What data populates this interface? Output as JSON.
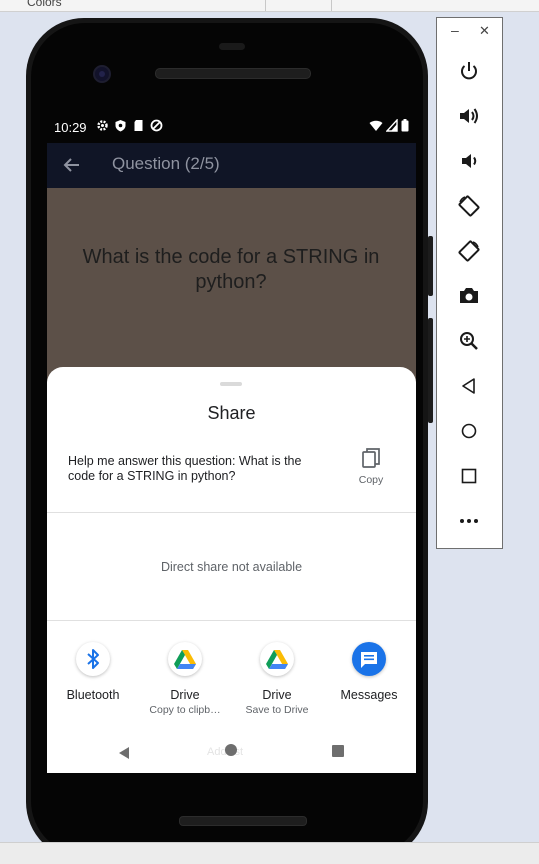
{
  "ide": {
    "tab_label": "Colors"
  },
  "device": {
    "status_bar": {
      "time": "10:29"
    },
    "app_bar": {
      "title": "Question (2/5)"
    },
    "question": {
      "text": "What is the code for a STRING in python?"
    },
    "share_sheet": {
      "title": "Share",
      "shared_text": "Help me answer this question: What is the code for a STRING in python?",
      "copy_label": "Copy",
      "direct_share_text": "Direct share not available",
      "targets": [
        {
          "name": "Bluetooth",
          "subtitle": "",
          "icon": "bluetooth-icon"
        },
        {
          "name": "Drive",
          "subtitle": "Copy to clipb…",
          "icon": "google-drive-icon"
        },
        {
          "name": "Drive",
          "subtitle": "Save to Drive",
          "icon": "google-drive-icon"
        },
        {
          "name": "Messages",
          "subtitle": "",
          "icon": "messages-icon"
        }
      ],
      "ghost_text": "Add list"
    }
  },
  "emulator_controls": {
    "minimize": "–",
    "close": "✕",
    "buttons": [
      "power-icon",
      "volume-up-icon",
      "volume-down-icon",
      "rotate-left-icon",
      "rotate-right-icon",
      "camera-icon",
      "zoom-icon",
      "back-icon",
      "home-icon",
      "overview-icon",
      "more-icon"
    ]
  },
  "colors": {
    "app_bar": "#101526",
    "scrim_background": "#5c5048",
    "messages_blue": "#1a73e8",
    "bluetooth_blue": "#1a73e8"
  }
}
